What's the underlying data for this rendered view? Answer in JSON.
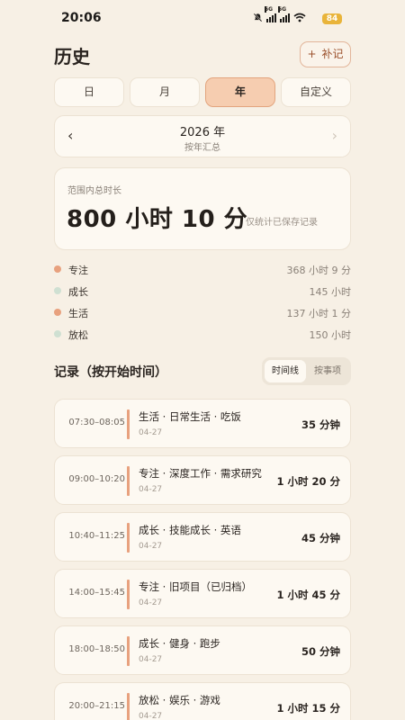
{
  "status": {
    "time": "20:06",
    "battery": "84",
    "network_1": "5G",
    "network_2": "5G"
  },
  "header": {
    "title": "历史",
    "add_button": {
      "icon": "plus-icon",
      "label": "补记"
    }
  },
  "tabs": [
    {
      "label": "日"
    },
    {
      "label": "月"
    },
    {
      "label": "年",
      "active": true
    },
    {
      "label": "自定义"
    }
  ],
  "period": {
    "main": "2026 年",
    "sub": "按年汇总",
    "prev_icon": "chevron-left-icon",
    "next_icon": "chevron-right-icon"
  },
  "summary": {
    "label": "范围内总时长",
    "value": "800 小时 10 分",
    "note": "仅统计已保存记录"
  },
  "categories": [
    {
      "name": "专注",
      "value": "368 小时 9 分",
      "color": "#e8a17e"
    },
    {
      "name": "成长",
      "value": "145 小时",
      "color": "#cfe0d2"
    },
    {
      "name": "生活",
      "value": "137 小时 1 分",
      "color": "#e8a17e"
    },
    {
      "name": "放松",
      "value": "150 小时",
      "color": "#cfe0d2"
    }
  ],
  "records_section": {
    "title": "记录（按开始时间）",
    "toggle": {
      "on": "时间线",
      "off": "按事项"
    }
  },
  "records": [
    {
      "time": "07:30–08:05",
      "title": "生活 · 日常生活 · 吃饭",
      "date": "04-27",
      "duration": "35 分钟"
    },
    {
      "time": "09:00–10:20",
      "title": "专注 · 深度工作 · 需求研究",
      "date": "04-27",
      "duration": "1 小时 20 分"
    },
    {
      "time": "10:40–11:25",
      "title": "成长 · 技能成长 · 英语",
      "date": "04-27",
      "duration": "45 分钟"
    },
    {
      "time": "14:00–15:45",
      "title": "专注 · 旧项目（已归档）",
      "date": "04-27",
      "duration": "1 小时 45 分"
    },
    {
      "time": "18:00–18:50",
      "title": "成长 · 健身 · 跑步",
      "date": "04-27",
      "duration": "50 分钟"
    },
    {
      "time": "20:00–21:15",
      "title": "放松 · 娱乐 · 游戏",
      "date": "04-27",
      "duration": "1 小时 15 分"
    }
  ]
}
